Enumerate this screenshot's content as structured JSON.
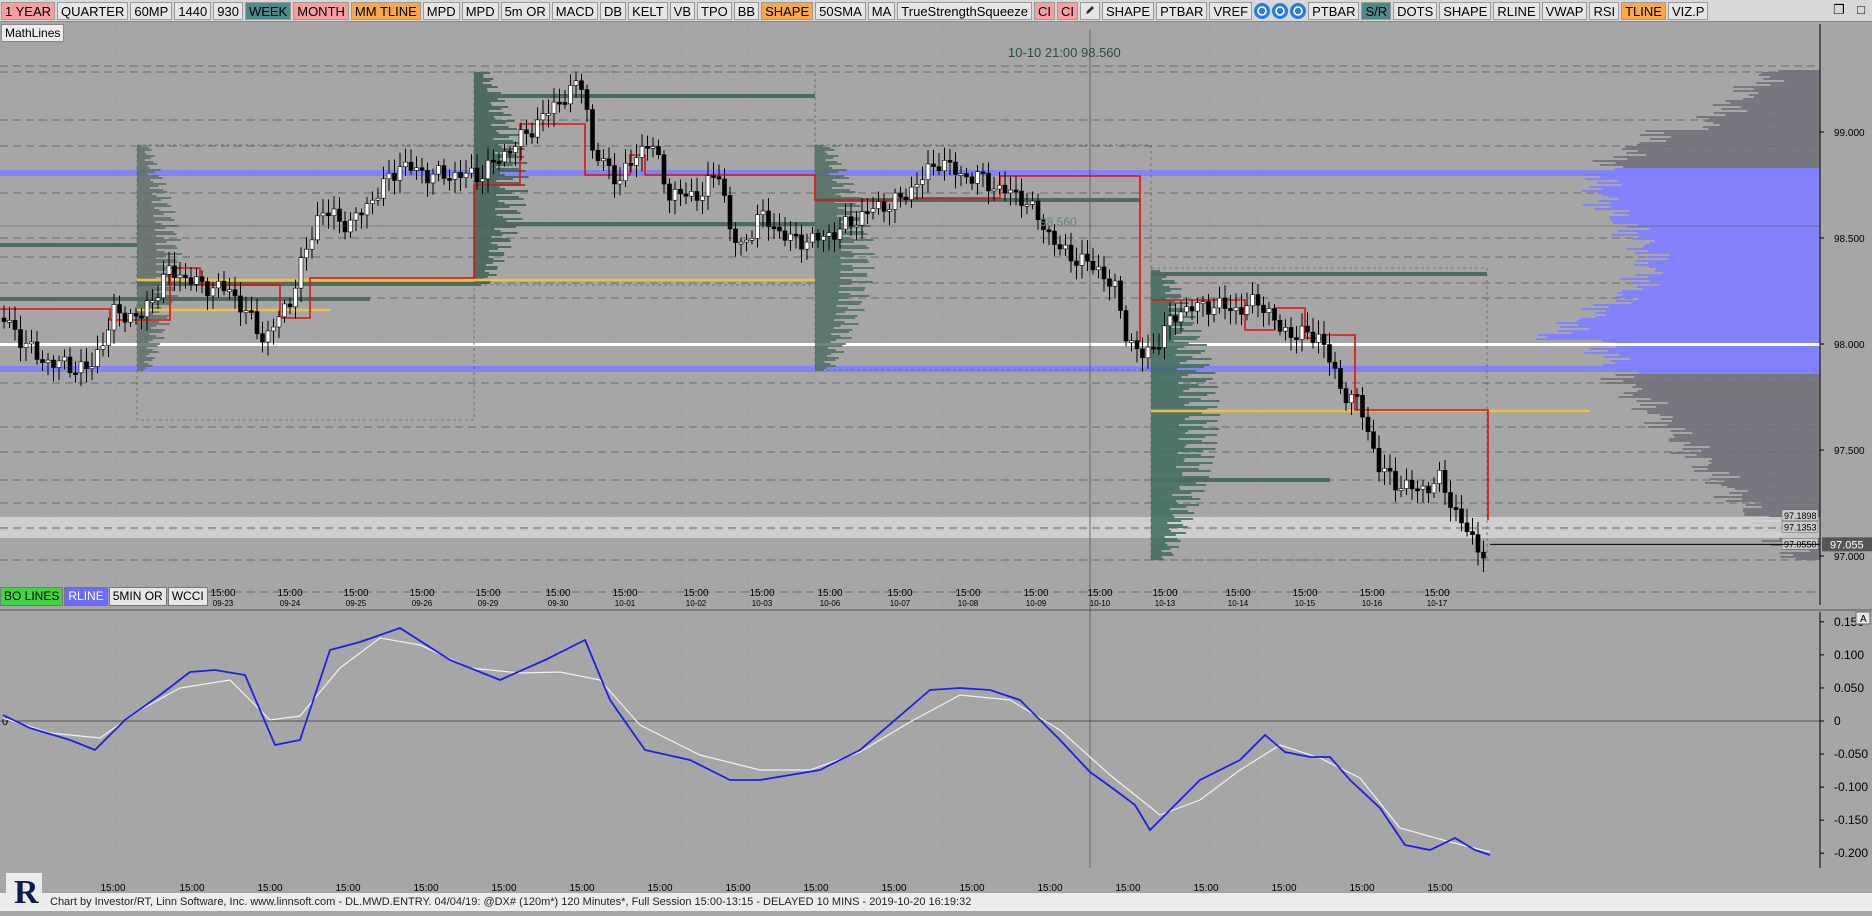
{
  "toolbar": {
    "buttons": [
      {
        "label": "1 YEAR",
        "bg": "#f4a0a0"
      },
      {
        "label": "QUARTER",
        "bg": "#e6e6e6"
      },
      {
        "label": "60MP",
        "bg": "#e6e6e6"
      },
      {
        "label": "1440",
        "bg": "#e6e6e6"
      },
      {
        "label": "930",
        "bg": "#e6e6e6"
      },
      {
        "label": "WEEK",
        "bg": "#4f8a8a"
      },
      {
        "label": "MONTH",
        "bg": "#f4a0a0"
      },
      {
        "label": "MM TLINE",
        "bg": "#f7a94a"
      },
      {
        "label": "MPD",
        "bg": "#e6e6e6"
      },
      {
        "label": "MPD",
        "bg": "#e6e6e6"
      },
      {
        "label": "5m OR",
        "bg": "#e6e6e6"
      },
      {
        "label": "MACD",
        "bg": "#e6e6e6"
      },
      {
        "label": "DB",
        "bg": "#e6e6e6"
      },
      {
        "label": "KELT",
        "bg": "#e6e6e6"
      },
      {
        "label": "VB",
        "bg": "#e6e6e6"
      },
      {
        "label": "TPO",
        "bg": "#e6e6e6"
      },
      {
        "label": "BB",
        "bg": "#e6e6e6"
      },
      {
        "label": "SHAPE",
        "bg": "#f7a94a"
      },
      {
        "label": "50SMA",
        "bg": "#e6e6e6"
      },
      {
        "label": "MA",
        "bg": "#e6e6e6"
      },
      {
        "label": "TrueStrengthSqueeze",
        "bg": "#e6e6e6"
      },
      {
        "label": "CI",
        "bg": "#f4a0a0"
      },
      {
        "label": "CI",
        "bg": "#f4a0a0"
      }
    ],
    "icon_pencil": "pencil-icon",
    "buttons2": [
      {
        "label": "SHAPE",
        "bg": "#e6e6e6"
      },
      {
        "label": "PTBAR",
        "bg": "#e6e6e6"
      },
      {
        "label": "VREF",
        "bg": "#e6e6e6"
      }
    ],
    "round_icons": [
      "refresh-icon",
      "reload-icon",
      "clock-icon"
    ],
    "buttons3": [
      {
        "label": "PTBAR",
        "bg": "#e6e6e6"
      },
      {
        "label": "S/R",
        "bg": "#4f8a8a"
      },
      {
        "label": "DOTS",
        "bg": "#e6e6e6"
      },
      {
        "label": "SHAPE",
        "bg": "#e6e6e6"
      },
      {
        "label": "RLINE",
        "bg": "#e6e6e6"
      },
      {
        "label": "VWAP",
        "bg": "#e6e6e6"
      },
      {
        "label": "RSI",
        "bg": "#e6e6e6"
      },
      {
        "label": "TLINE",
        "bg": "#f7a94a"
      },
      {
        "label": "VIZ.P",
        "bg": "#e6e6e6"
      }
    ]
  },
  "window_controls": {
    "restore": "❐",
    "close": "□"
  },
  "mathlines_label": "MathLines",
  "ohlc_label": "10-10 21:00  98.560",
  "crosshair_price_label": "98.560",
  "price_axis": {
    "labels": [
      {
        "text": "99.000",
        "price": 99.0
      },
      {
        "text": "98.500",
        "price": 98.5
      },
      {
        "text": "98.000",
        "price": 98.0
      },
      {
        "text": "97.500",
        "price": 97.5
      },
      {
        "text": "97.000",
        "price": 97.0
      }
    ],
    "small_tags": [
      {
        "text": "97.1898",
        "price": 97.1898
      },
      {
        "text": "97.1353",
        "price": 97.1353
      },
      {
        "text": "97.0550",
        "price": 97.055
      }
    ],
    "current_price": {
      "text": "97.055",
      "color": "#ffffff"
    }
  },
  "date_axis": [
    {
      "time": "15:00",
      "date": "09-23"
    },
    {
      "time": "15:00",
      "date": "09-24"
    },
    {
      "time": "15:00",
      "date": "09-25"
    },
    {
      "time": "15:00",
      "date": "09-26"
    },
    {
      "time": "15:00",
      "date": "09-29"
    },
    {
      "time": "15:00",
      "date": "09-30"
    },
    {
      "time": "15:00",
      "date": "10-01"
    },
    {
      "time": "15:00",
      "date": "10-02"
    },
    {
      "time": "15:00",
      "date": "10-03"
    },
    {
      "time": "15:00",
      "date": "10-06"
    },
    {
      "time": "15:00",
      "date": "10-07"
    },
    {
      "time": "15:00",
      "date": "10-08"
    },
    {
      "time": "15:00",
      "date": "10-09"
    },
    {
      "time": "15:00",
      "date": "10-10"
    },
    {
      "time": "15:00",
      "date": "10-13"
    },
    {
      "time": "15:00",
      "date": "10-14"
    },
    {
      "time": "15:00",
      "date": "10-15"
    },
    {
      "time": "15:00",
      "date": "10-16"
    },
    {
      "time": "15:00",
      "date": "10-17"
    }
  ],
  "bottom_buttons": [
    {
      "label": "BO LINES",
      "bg": "#3fd63f"
    },
    {
      "label": "RLINE",
      "bg": "#6b6bff"
    },
    {
      "label": "5MIN OR",
      "bg": "#e6e6e6"
    },
    {
      "label": "WCCI",
      "bg": "#e6e6e6"
    }
  ],
  "oscillator_axis": [
    {
      "text": "0.150",
      "value": 0.15
    },
    {
      "text": "0.100",
      "value": 0.1
    },
    {
      "text": "0.050",
      "value": 0.05
    },
    {
      "text": "0",
      "value": 0
    },
    {
      "text": "-0.050",
      "value": -0.05
    },
    {
      "text": "-0.100",
      "value": -0.1
    },
    {
      "text": "-0.150",
      "value": -0.15
    },
    {
      "text": "-0.200",
      "value": -0.2
    }
  ],
  "oscillator_zero_tag": "0",
  "oscillator_axis_cap": "A",
  "osc_time_labels": [
    "15:00",
    "15:00",
    "15:00",
    "15:00",
    "15:00",
    "15:00",
    "15:00",
    "15:00",
    "15:00",
    "15:00",
    "15:00",
    "15:00",
    "15:00",
    "15:00",
    "15:00",
    "15:00",
    "15:00",
    "15:00",
    "15:00"
  ],
  "footer_text": "Chart by Investor/RT, Linn Software, Inc. www.linnsoft.com - DL.MWD.ENTRY.   04/04/19: @DX# (120m*) 120 Minutes*, Full Session 15:00-13:15 - DELAYED 10 MINS - 2019-10-20 16:19:32",
  "logo_letter": "R",
  "colors": {
    "background": "#a6a6a6",
    "volume_profile": "#6f6f78",
    "value_area": "#8080ff",
    "poc": "#ffffff",
    "composite_profile_small": "#3f6b5f",
    "red_line": "#e01010",
    "orange_line": "#f0c040",
    "osc_main": "#2020e0",
    "osc_signal": "#f0f0f0"
  }
}
